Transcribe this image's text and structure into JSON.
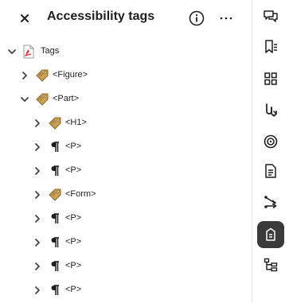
{
  "header": {
    "title": "Accessibility tags",
    "close_icon": "close-icon",
    "info_icon": "info-icon",
    "more_icon": "more-options-icon"
  },
  "tree": {
    "root": {
      "label": "Tags",
      "icon": "pdf-file-icon",
      "expanded": true
    },
    "items": [
      {
        "label": "<Figure>",
        "icon": "tag-icon",
        "expanded": false
      },
      {
        "label": "<Part>",
        "icon": "tag-icon",
        "expanded": true
      },
      {
        "label": "<H1>",
        "icon": "tag-icon",
        "expanded": false
      },
      {
        "label": "<P>",
        "icon": "paragraph-icon",
        "expanded": false
      },
      {
        "label": "<P>",
        "icon": "paragraph-icon",
        "expanded": false
      },
      {
        "label": "<Form>",
        "icon": "tag-icon",
        "expanded": false
      },
      {
        "label": "<P>",
        "icon": "paragraph-icon",
        "expanded": false
      },
      {
        "label": "<P>",
        "icon": "paragraph-icon",
        "expanded": false
      },
      {
        "label": "<P>",
        "icon": "paragraph-icon",
        "expanded": false
      },
      {
        "label": "<P>",
        "icon": "paragraph-icon",
        "expanded": false
      }
    ]
  },
  "rail": {
    "items": [
      {
        "icon": "comments-icon"
      },
      {
        "icon": "bookmarks-icon"
      },
      {
        "icon": "thumbnails-icon"
      },
      {
        "icon": "attachments-icon"
      },
      {
        "icon": "layers-icon"
      },
      {
        "icon": "document-properties-icon"
      },
      {
        "icon": "order-icon"
      },
      {
        "icon": "accessibility-tags-icon",
        "active": true
      },
      {
        "icon": "content-structure-icon"
      }
    ]
  },
  "colors": {
    "accent_active_bg": "#3b3b3b",
    "pdf_red": "#d7373f",
    "tag_gold": "#c9a15a"
  }
}
